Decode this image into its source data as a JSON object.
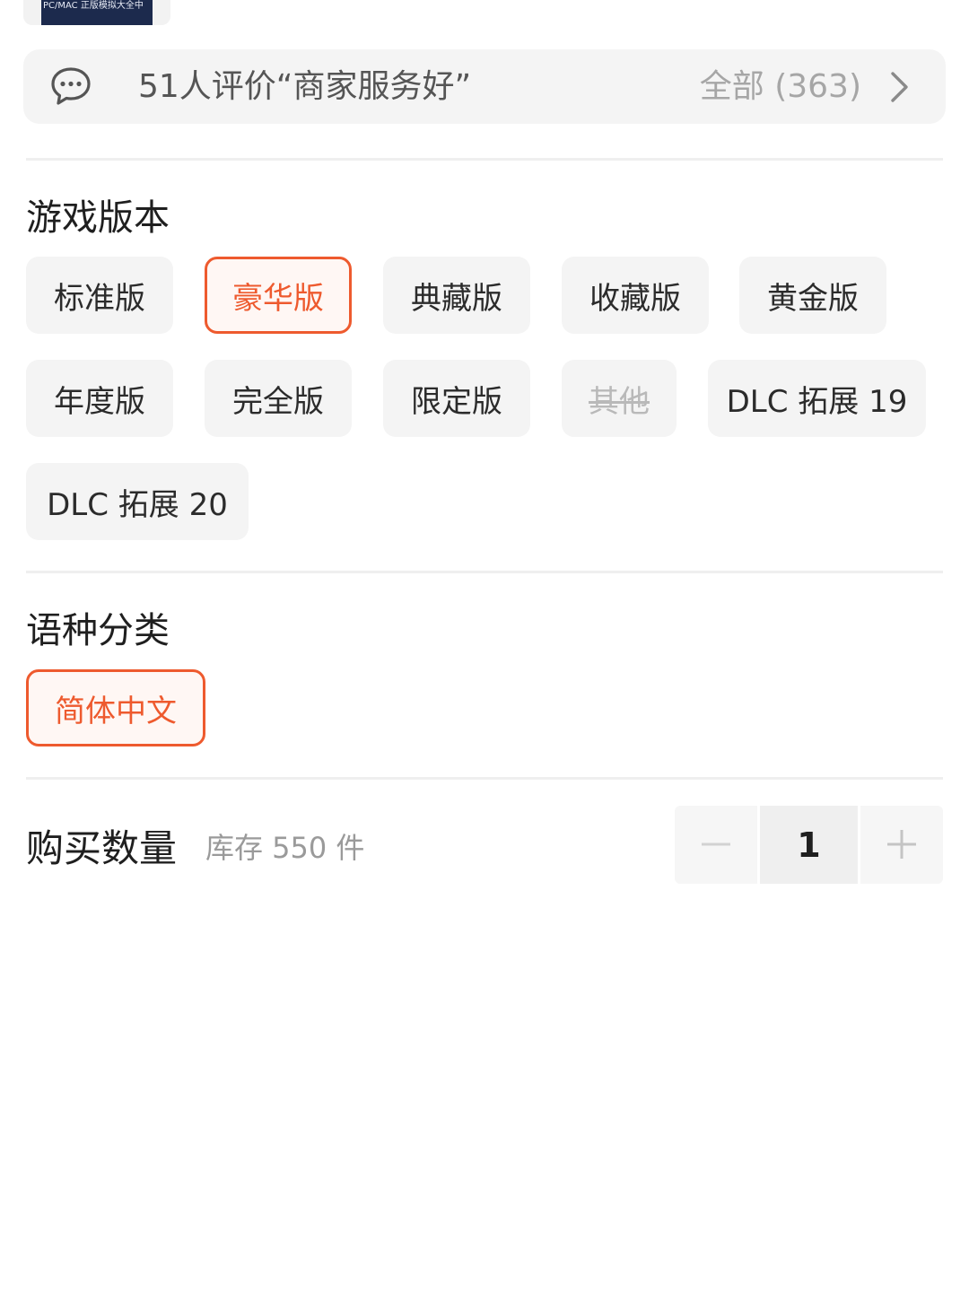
{
  "product_thumb": {
    "caption": "PC/MAC 正版模拟大全中"
  },
  "review_bar": {
    "icon": "chat-bubble-icon",
    "text": "51人评价“商家服务好”",
    "all_label": "全部 (363)",
    "chevron": "chevron-right-icon"
  },
  "game_version": {
    "title": "游戏版本",
    "options": [
      {
        "label": "标准版",
        "state": "normal"
      },
      {
        "label": "豪华版",
        "state": "selected"
      },
      {
        "label": "典藏版",
        "state": "normal"
      },
      {
        "label": "收藏版",
        "state": "normal"
      },
      {
        "label": "黄金版",
        "state": "normal"
      },
      {
        "label": "年度版",
        "state": "normal"
      },
      {
        "label": "完全版",
        "state": "normal"
      },
      {
        "label": "限定版",
        "state": "normal"
      },
      {
        "label": "其他",
        "state": "disabled"
      },
      {
        "label": "DLC 拓展 19",
        "state": "normal"
      },
      {
        "label": "DLC 拓展 20",
        "state": "normal"
      }
    ]
  },
  "language": {
    "title": "语种分类",
    "options": [
      {
        "label": "简体中文",
        "state": "selected"
      }
    ]
  },
  "purchase": {
    "label": "购买数量",
    "stock": "库存 550 件",
    "quantity": "1"
  },
  "colors": {
    "accent": "#ee5a2e",
    "chip_bg": "#f4f4f4",
    "disabled_text": "#b9b9b9"
  }
}
